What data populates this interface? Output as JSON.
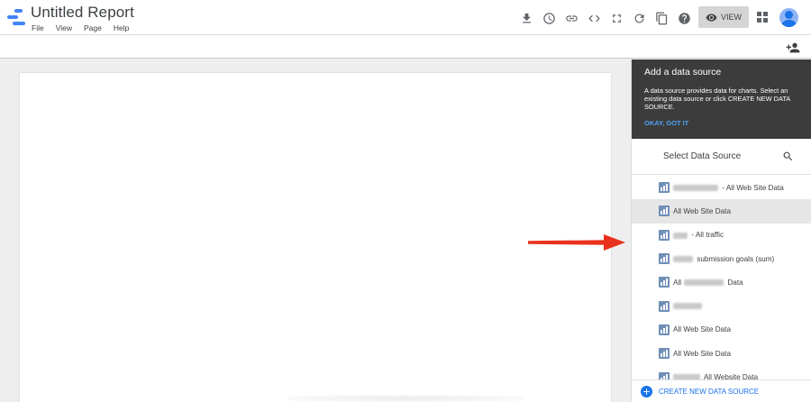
{
  "app": {
    "title": "Untitled Report",
    "menu": [
      "File",
      "View",
      "Page",
      "Help"
    ]
  },
  "toolbar": {
    "icons": [
      "download-icon",
      "schedule-icon",
      "link-icon",
      "embed-icon",
      "fullscreen-icon",
      "refresh-icon",
      "copy-icon",
      "help-icon"
    ],
    "view_label": "VIEW"
  },
  "tooltip": {
    "title": "Add a data source",
    "body": "A data source provides data for charts. Select an existing data source or click CREATE NEW DATA SOURCE.",
    "button": "OKAY, GOT IT"
  },
  "data_source_panel": {
    "header": "Select Data Source",
    "items": [
      {
        "prefix_redacted": true,
        "label": " - All Web Site Data"
      },
      {
        "prefix_redacted": false,
        "label": "All Web Site Data"
      },
      {
        "prefix_redacted": true,
        "label": " - All traffic"
      },
      {
        "prefix_redacted": true,
        "label": " submission goals (sum)"
      },
      {
        "prefix_redacted": false,
        "label": "All",
        "mid_redacted": true,
        "suffix": " Data"
      },
      {
        "prefix_redacted": true,
        "label": ""
      },
      {
        "prefix_redacted": false,
        "label": "All Web Site Data"
      },
      {
        "prefix_redacted": false,
        "label": "All Web Site Data"
      },
      {
        "prefix_redacted": true,
        "label": " All Website Data"
      }
    ],
    "selected_index": 1,
    "footer_label": "CREATE NEW DATA SOURCE"
  },
  "colors": {
    "accent": "#1a73e8",
    "tooltip_bg": "#3c3c3c",
    "arrow": "#e8321e",
    "datasource_icon": "#6f8fb5"
  }
}
